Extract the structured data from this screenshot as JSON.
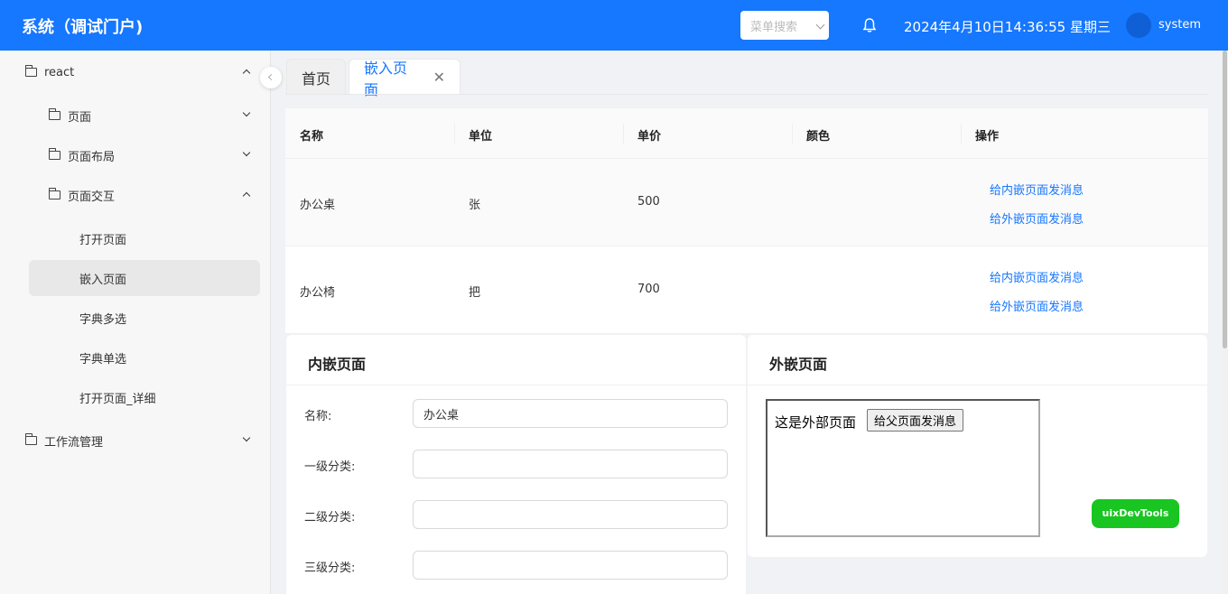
{
  "header": {
    "title": "系统（调试门户)",
    "search_placeholder": "菜单搜索",
    "datetime": "2024年4月10日14:36:55 星期三",
    "username": "system"
  },
  "sidebar": {
    "items": [
      {
        "label": "react",
        "level": 0,
        "expanded": true
      },
      {
        "label": "页面",
        "level": 1,
        "expanded": false
      },
      {
        "label": "页面布局",
        "level": 1,
        "expanded": false
      },
      {
        "label": "页面交互",
        "level": 1,
        "expanded": true
      },
      {
        "label": "打开页面",
        "level": 2
      },
      {
        "label": "嵌入页面",
        "level": 2,
        "active": true
      },
      {
        "label": "字典多选",
        "level": 2
      },
      {
        "label": "字典单选",
        "level": 2
      },
      {
        "label": "打开页面_详细",
        "level": 2
      },
      {
        "label": "工作流管理",
        "level": 0,
        "expanded": false
      }
    ]
  },
  "tabs": [
    {
      "label": "首页"
    },
    {
      "label": "嵌入页面",
      "active": true
    }
  ],
  "table": {
    "columns": [
      "名称",
      "单位",
      "单价",
      "颜色",
      "操作"
    ],
    "rows": [
      {
        "name": "办公桌",
        "unit": "张",
        "price": "500",
        "color": "",
        "actions": [
          "给内嵌页面发消息",
          "给外嵌页面发消息"
        ]
      },
      {
        "name": "办公椅",
        "unit": "把",
        "price": "700",
        "color": "",
        "actions": [
          "给内嵌页面发消息",
          "给外嵌页面发消息"
        ]
      }
    ]
  },
  "inner_panel": {
    "title": "内嵌页面",
    "fields": [
      {
        "label": "名称:",
        "value": "办公桌"
      },
      {
        "label": "一级分类:",
        "value": ""
      },
      {
        "label": "二级分类:",
        "value": ""
      },
      {
        "label": "三级分类:",
        "value": ""
      }
    ]
  },
  "outer_panel": {
    "title": "外嵌页面",
    "iframe_text": "这是外部页面",
    "iframe_button": "给父页面发消息"
  },
  "devtools_label": "uixDevTools",
  "colors": {
    "primary": "#1677ff",
    "devtools": "#18c521"
  }
}
